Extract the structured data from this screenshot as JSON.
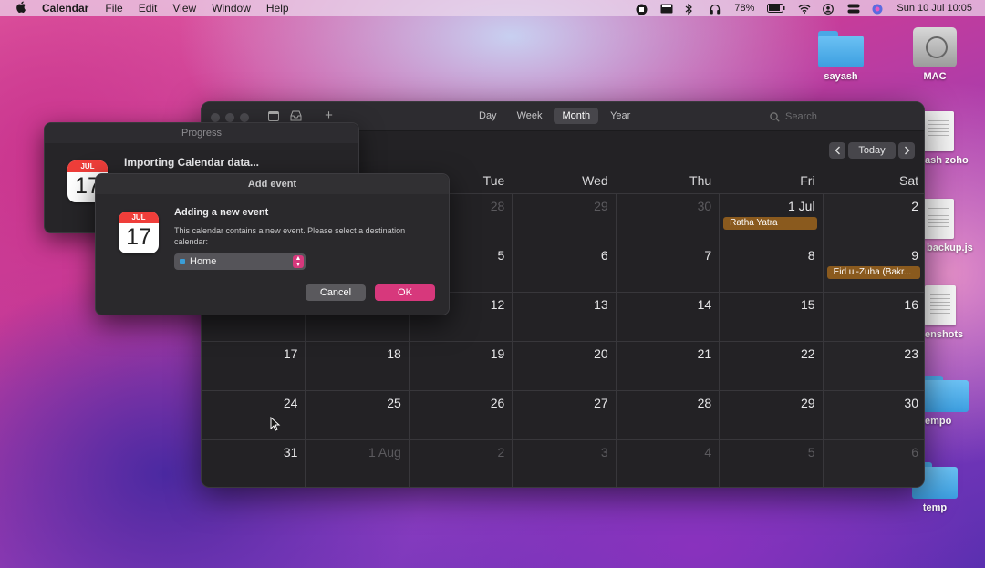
{
  "menubar": {
    "app_name": "Calendar",
    "menus": [
      "File",
      "Edit",
      "View",
      "Window",
      "Help"
    ],
    "battery": "78%",
    "datetime": "Sun 10 Jul  10:05"
  },
  "desktop": {
    "icons": [
      {
        "label": "sayash",
        "kind": "folder"
      },
      {
        "label": "MAC",
        "kind": "disk"
      },
      {
        "label": "ash zoho",
        "kind": "document"
      },
      {
        "label": "backup.js",
        "kind": "document"
      },
      {
        "label": "enshots",
        "kind": "document"
      },
      {
        "label": "empo",
        "kind": "folder"
      },
      {
        "label": "temp",
        "kind": "folder"
      }
    ]
  },
  "calendar": {
    "views": [
      "Day",
      "Week",
      "Month",
      "Year"
    ],
    "active_view": "Month",
    "search_placeholder": "Search",
    "today_label": "Today",
    "weekdays": [
      "",
      "",
      "Tue",
      "Wed",
      "Thu",
      "Fri",
      "Sat"
    ],
    "weeks": [
      [
        {
          "d": ""
        },
        {
          "d": ""
        },
        {
          "d": "28",
          "dim": true
        },
        {
          "d": "29",
          "dim": true
        },
        {
          "d": "30",
          "dim": true
        },
        {
          "d": "1 Jul"
        },
        {
          "d": "2"
        }
      ],
      [
        {
          "d": ""
        },
        {
          "d": ""
        },
        {
          "d": "5"
        },
        {
          "d": "6"
        },
        {
          "d": "7"
        },
        {
          "d": "8"
        },
        {
          "d": "9"
        }
      ],
      [
        {
          "d": ""
        },
        {
          "d": ""
        },
        {
          "d": "12"
        },
        {
          "d": "13"
        },
        {
          "d": "14"
        },
        {
          "d": "15"
        },
        {
          "d": "16"
        }
      ],
      [
        {
          "d": "17"
        },
        {
          "d": "18"
        },
        {
          "d": "19"
        },
        {
          "d": "20"
        },
        {
          "d": "21"
        },
        {
          "d": "22"
        },
        {
          "d": "23"
        }
      ],
      [
        {
          "d": "24"
        },
        {
          "d": "25"
        },
        {
          "d": "26"
        },
        {
          "d": "27"
        },
        {
          "d": "28"
        },
        {
          "d": "29"
        },
        {
          "d": "30"
        }
      ],
      [
        {
          "d": "31"
        },
        {
          "d": "1 Aug",
          "dim": true
        },
        {
          "d": "2",
          "dim": true
        },
        {
          "d": "3",
          "dim": true
        },
        {
          "d": "4",
          "dim": true
        },
        {
          "d": "5",
          "dim": true
        },
        {
          "d": "6",
          "dim": true
        }
      ]
    ],
    "events": [
      {
        "week": 0,
        "day": 5,
        "title": "Ratha Yatra",
        "color": "#8a5a1e"
      },
      {
        "week": 1,
        "day": 6,
        "title": "Eid ul-Zuha (Bakr...",
        "color": "#8a5a1e"
      }
    ]
  },
  "progress": {
    "title": "Progress",
    "message": "Importing Calendar data...",
    "icon_month": "JUL",
    "icon_day": "17"
  },
  "dialog": {
    "title": "Add event",
    "heading": "Adding a new event",
    "body": "This calendar contains a new event. Please select a destination calendar:",
    "selected_calendar": "Home",
    "cancel_label": "Cancel",
    "ok_label": "OK",
    "icon_month": "JUL",
    "icon_day": "17"
  }
}
